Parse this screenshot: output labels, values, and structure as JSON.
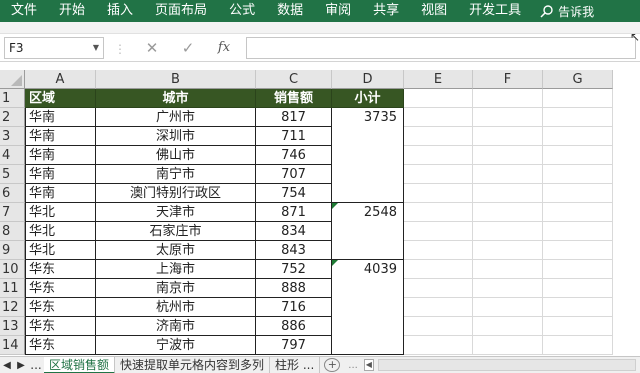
{
  "ribbon": {
    "tabs": [
      "文件",
      "开始",
      "插入",
      "页面布局",
      "公式",
      "数据",
      "审阅",
      "共享",
      "视图",
      "开发工具"
    ],
    "tell_me": "告诉我"
  },
  "formula_bar": {
    "name_box": "F3",
    "fx": "fx",
    "formula": ""
  },
  "columns": [
    "A",
    "B",
    "C",
    "D",
    "E",
    "F",
    "G"
  ],
  "rows": [
    "1",
    "2",
    "3",
    "4",
    "5",
    "6",
    "7",
    "8",
    "9",
    "10",
    "11",
    "12",
    "13",
    "14"
  ],
  "table": {
    "headers": [
      "区域",
      "城市",
      "销售额",
      "小计"
    ],
    "data": [
      [
        "华南",
        "广州市",
        "817"
      ],
      [
        "华南",
        "深圳市",
        "711"
      ],
      [
        "华南",
        "佛山市",
        "746"
      ],
      [
        "华南",
        "南宁市",
        "707"
      ],
      [
        "华南",
        "澳门特别行政区",
        "754"
      ],
      [
        "华北",
        "天津市",
        "871"
      ],
      [
        "华北",
        "石家庄市",
        "834"
      ],
      [
        "华北",
        "太原市",
        "843"
      ],
      [
        "华东",
        "上海市",
        "752"
      ],
      [
        "华东",
        "南京市",
        "888"
      ],
      [
        "华东",
        "杭州市",
        "716"
      ],
      [
        "华东",
        "济南市",
        "886"
      ],
      [
        "华东",
        "宁波市",
        "797"
      ]
    ],
    "subtotals": [
      "3735",
      "2548",
      "4039"
    ]
  },
  "sheet_tabs": {
    "nav_dots": "...",
    "tabs": [
      "区域销售额",
      "快速提取单元格内容到多列",
      "柱形 ..."
    ],
    "add": "+",
    "more": "..."
  }
}
